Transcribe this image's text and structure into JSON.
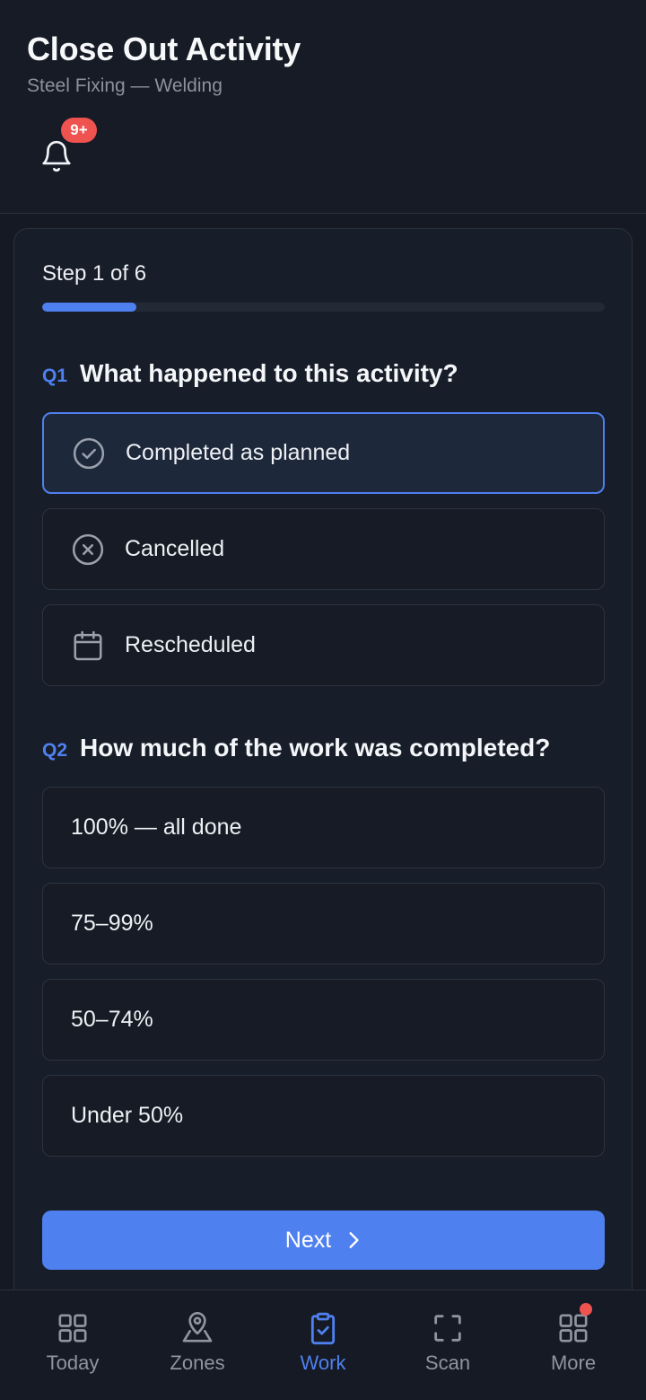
{
  "header": {
    "title": "Close Out Activity",
    "subtitle": "Steel Fixing — Welding",
    "notification_badge": "9+"
  },
  "wizard": {
    "step_label": "Step 1 of 6",
    "progress_fraction": 0.1667
  },
  "q1": {
    "number": "Q1",
    "text": "What happened to this activity?",
    "options": [
      {
        "label": "Completed as planned",
        "icon": "check-circle-icon",
        "selected": true
      },
      {
        "label": "Cancelled",
        "icon": "x-circle-icon",
        "selected": false
      },
      {
        "label": "Rescheduled",
        "icon": "calendar-icon",
        "selected": false
      }
    ]
  },
  "q2": {
    "number": "Q2",
    "text": "How much of the work was completed?",
    "options": [
      {
        "label": "100% — all done"
      },
      {
        "label": "75–99%"
      },
      {
        "label": "50–74%"
      },
      {
        "label": "Under 50%"
      }
    ]
  },
  "actions": {
    "next_label": "Next"
  },
  "tabbar": {
    "items": [
      {
        "label": "Today",
        "icon": "grid-icon",
        "active": false
      },
      {
        "label": "Zones",
        "icon": "map-pin-icon",
        "active": false
      },
      {
        "label": "Work",
        "icon": "clipboard-check-icon",
        "active": true
      },
      {
        "label": "Scan",
        "icon": "scan-frame-icon",
        "active": false
      },
      {
        "label": "More",
        "icon": "apps-icon",
        "active": false
      }
    ]
  },
  "colors": {
    "accent": "#4f80ef",
    "badge": "#ef5350",
    "background": "#141923"
  }
}
